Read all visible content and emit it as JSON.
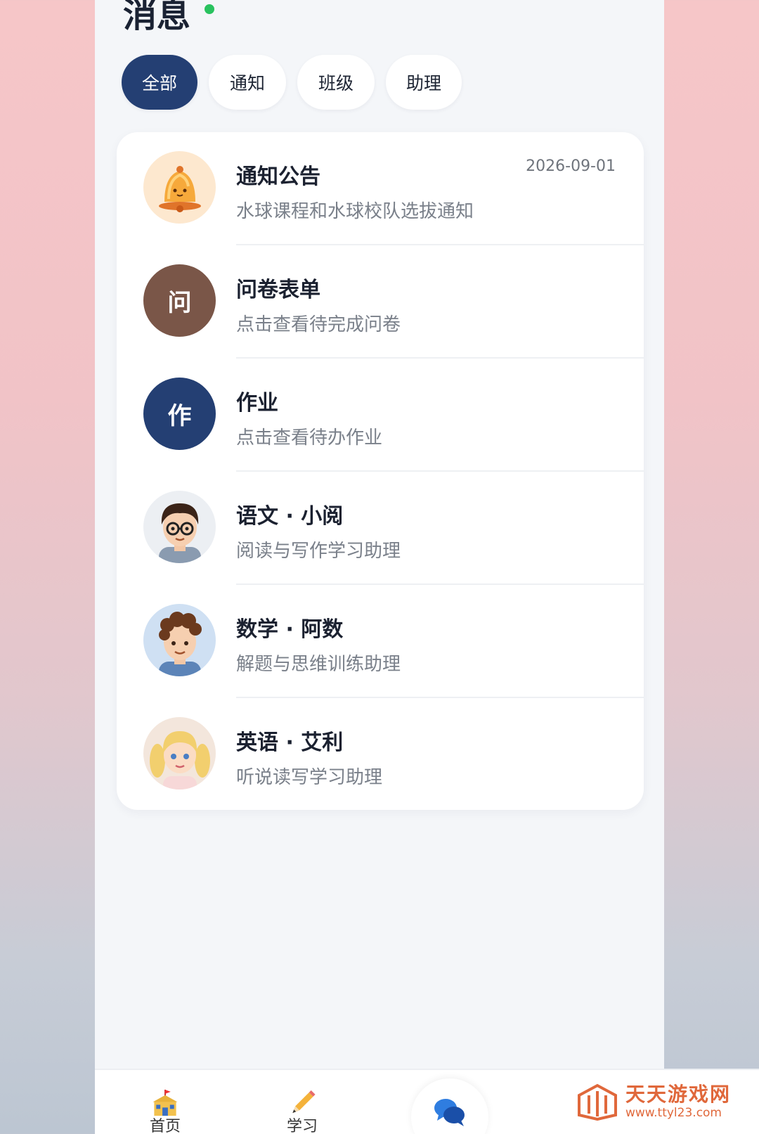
{
  "header": {
    "title": "消息"
  },
  "tabs": [
    {
      "label": "全部",
      "active": true
    },
    {
      "label": "通知",
      "active": false
    },
    {
      "label": "班级",
      "active": false
    },
    {
      "label": "助理",
      "active": false
    }
  ],
  "messages": [
    {
      "name": "通知公告",
      "subtitle": "水球课程和水球校队选拔通知",
      "date": "2026-09-01",
      "avatar_icon": "bell-icon"
    },
    {
      "name": "问卷表单",
      "subtitle": "点击查看待完成问卷",
      "avatar_text": "问",
      "avatar_color": "#7a5648"
    },
    {
      "name": "作业",
      "subtitle": "点击查看待办作业",
      "avatar_text": "作",
      "avatar_color": "#243f73"
    },
    {
      "name": "语文 · 小阅",
      "subtitle": "阅读与写作学习助理",
      "avatar_icon": "boy-glasses-avatar"
    },
    {
      "name": "数学 · 阿数",
      "subtitle": "解题与思维训练助理",
      "avatar_icon": "boy-curly-avatar"
    },
    {
      "name": "英语 · 艾利",
      "subtitle": "听说读写学习助理",
      "avatar_icon": "girl-blonde-avatar"
    }
  ],
  "bottom_nav": [
    {
      "label": "首页",
      "icon": "school-icon"
    },
    {
      "label": "学习",
      "icon": "pencil-icon"
    },
    {
      "label": "",
      "icon": "chat-bubbles-icon"
    }
  ],
  "watermark": {
    "title": "天天游戏网",
    "url": "www.ttyl23.com"
  },
  "colors": {
    "accent": "#243f73",
    "online": "#29c25f",
    "brown": "#7a5648"
  }
}
